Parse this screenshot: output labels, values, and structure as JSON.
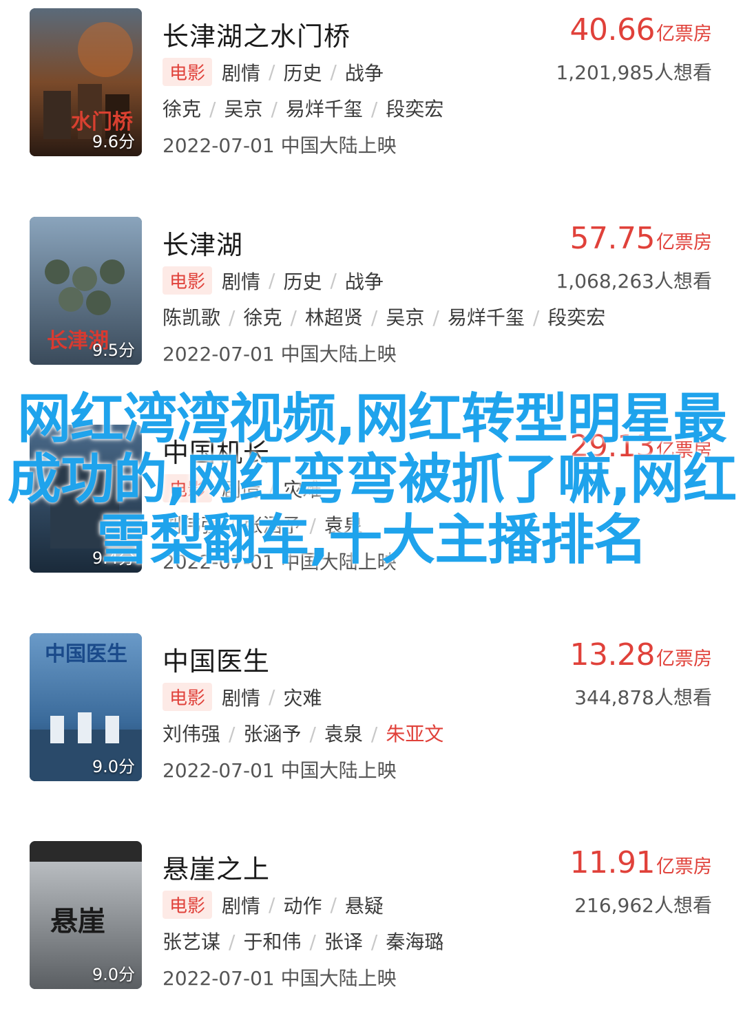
{
  "movies": [
    {
      "title": "长津湖之水门桥",
      "score": "9.6分",
      "box_office_num": "40.66",
      "box_office_unit": "亿票房",
      "tag": "电影",
      "genres": [
        "剧情",
        "历史",
        "战争"
      ],
      "want": "1,201,985人想看",
      "cast": [
        "徐克",
        "吴京",
        "易烊千玺",
        "段奕宏"
      ],
      "release": "2022-07-01 中国大陆上映",
      "poster_icon": "war-poster"
    },
    {
      "title": "长津湖",
      "score": "9.5分",
      "box_office_num": "57.75",
      "box_office_unit": "亿票房",
      "tag": "电影",
      "genres": [
        "剧情",
        "历史",
        "战争"
      ],
      "want": "1,068,263人想看",
      "cast": [
        "陈凯歌",
        "徐克",
        "林超贤",
        "吴京",
        "易烊千玺",
        "段奕宏"
      ],
      "release": "2022-07-01 中国大陆上映",
      "poster_icon": "snow-war-poster"
    },
    {
      "title": "中国机长",
      "score": "9.4分",
      "box_office_num": "29.13",
      "box_office_unit": "亿票房",
      "tag": "电影",
      "genres": [
        "剧情",
        "灾难"
      ],
      "want": "",
      "cast": [
        "刘伟强",
        "张涵予",
        "袁泉"
      ],
      "release": "2022-07-01 中国大陆上映",
      "poster_icon": "pilot-poster"
    },
    {
      "title": "中国医生",
      "score": "9.0分",
      "box_office_num": "13.28",
      "box_office_unit": "亿票房",
      "tag": "电影",
      "genres": [
        "剧情",
        "灾难"
      ],
      "want": "344,878人想看",
      "cast": [
        "刘伟强",
        "张涵予",
        "袁泉",
        "朱亚文"
      ],
      "cast_highlight_index": 3,
      "release": "2022-07-01 中国大陆上映",
      "poster_icon": "doctor-poster"
    },
    {
      "title": "悬崖之上",
      "score": "9.0分",
      "box_office_num": "11.91",
      "box_office_unit": "亿票房",
      "tag": "电影",
      "genres": [
        "剧情",
        "动作",
        "悬疑"
      ],
      "want": "216,962人想看",
      "cast": [
        "张艺谋",
        "于和伟",
        "张译",
        "秦海璐"
      ],
      "release": "2022-07-01 中国大陆上映",
      "poster_icon": "snow-cliff-poster"
    }
  ],
  "overlay_caption": "网红湾湾视频,网红转型明星最成功的,网红弯弯被抓了嘛,网红雪梨翻车,十大主播排名",
  "colors": {
    "accent_red": "#e0413a",
    "tag_bg": "#fdeae6",
    "overlay_blue": "#1fa3ec"
  }
}
